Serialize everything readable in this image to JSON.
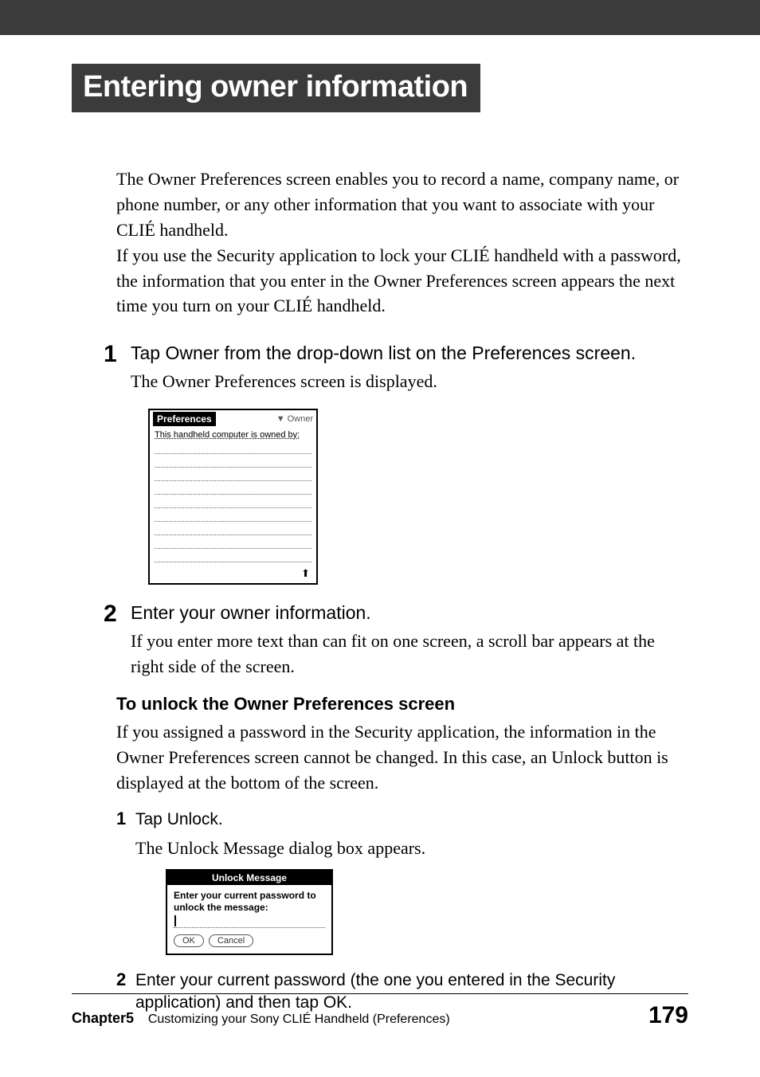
{
  "title": "Entering owner information",
  "intro": {
    "p1": "The Owner Preferences screen enables you to record a name, company name, or phone number, or any other information that you want to associate with your CLIÉ handheld.",
    "p2": "If you use the Security application to lock your CLIÉ handheld with a password, the information that you enter in the Owner Preferences screen appears the next time you turn on your CLIÉ handheld."
  },
  "steps": {
    "s1": {
      "num": "1",
      "title": "Tap Owner from the drop-down list on the Preferences screen.",
      "desc": "The Owner Preferences screen is displayed."
    },
    "s2": {
      "num": "2",
      "title": "Enter your owner information.",
      "desc": "If you enter more text than can fit on one screen, a scroll bar appears at the right side of the screen."
    }
  },
  "owner_screenshot": {
    "header_label": "Preferences",
    "dropdown_label": "Owner",
    "body_text": "This handheld computer is owned by:"
  },
  "unlock_section": {
    "heading": "To unlock the Owner Preferences screen",
    "desc": "If you assigned a password in the Security application, the information in the Owner Preferences screen cannot be changed. In this case, an Unlock button is displayed at the bottom of the screen.",
    "step1": {
      "num": "1",
      "title": "Tap Unlock.",
      "desc": "The Unlock Message dialog box appears."
    },
    "step2": {
      "num": "2",
      "title": "Enter your current password (the one you entered in the Security application) and then tap OK."
    }
  },
  "unlock_screenshot": {
    "title": "Unlock Message",
    "prompt": "Enter your current password to unlock the message:",
    "ok": "OK",
    "cancel": "Cancel"
  },
  "footer": {
    "chapter": "Chapter5",
    "chapter_title": "Customizing your Sony CLIÉ Handheld (Preferences)",
    "page": "179"
  }
}
